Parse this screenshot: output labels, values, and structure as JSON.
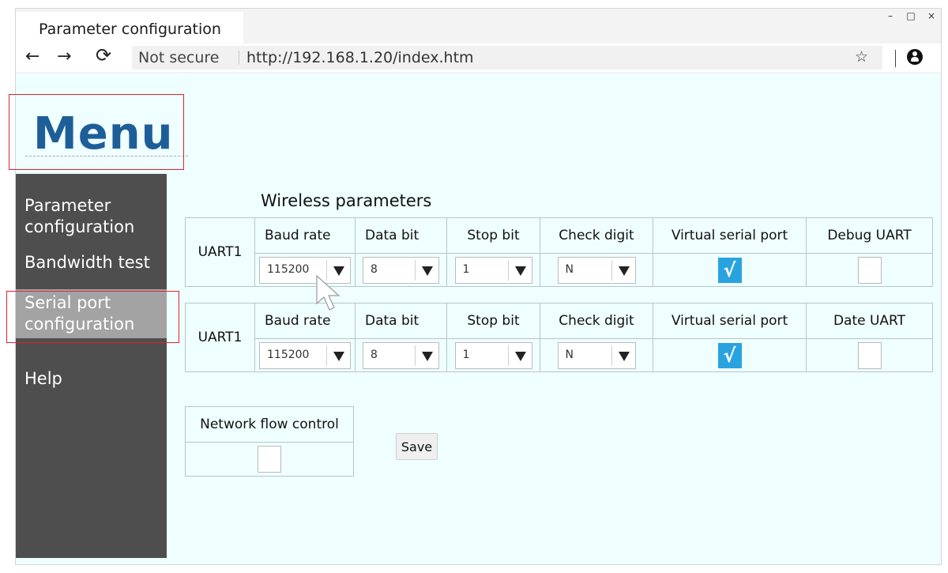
{
  "window": {
    "tab_title": "Parameter configuration",
    "controls": [
      "–",
      "□",
      "×"
    ]
  },
  "toolbar": {
    "back_icon": "←",
    "forward_icon": "→",
    "reload_icon": "⟳",
    "security_text": "Not secure",
    "url": "http://192.168.1.20/index.htm",
    "star_icon": "☆"
  },
  "page": {
    "menu_title": "Menu",
    "sidebar": [
      {
        "label": "Parameter configuration",
        "active": false
      },
      {
        "label": "Bandwidth test",
        "active": false
      },
      {
        "label": "Serial port configuration",
        "active": true
      },
      {
        "label": "Help",
        "active": false
      }
    ],
    "section_title": "Wireless parameters",
    "uart_tables": [
      {
        "row_label": "UART1",
        "headers": [
          "Baud rate",
          "Data bit",
          "Stop bit",
          "Check digit",
          "Virtual serial port",
          "Debug UART"
        ],
        "baud_rate": "115200",
        "data_bit": "8",
        "stop_bit": "1",
        "check_digit": "N",
        "virtual_serial_port": true,
        "last_checkbox": false
      },
      {
        "row_label": "UART1",
        "headers": [
          "Baud rate",
          "Data bit",
          "Stop bit",
          "Check digit",
          "Virtual serial port",
          "Date UART"
        ],
        "baud_rate": "115200",
        "data_bit": "8",
        "stop_bit": "1",
        "check_digit": "N",
        "virtual_serial_port": true,
        "last_checkbox": false
      }
    ],
    "flow_control": {
      "header": "Network flow control",
      "checked": false
    },
    "save_label": "Save",
    "check_mark": "√"
  },
  "colors": {
    "menu_title": "#1d5e99",
    "sidebar_bg": "#4e4e4e",
    "sidebar_active": "#a3a3a3",
    "page_bg": "#effefe",
    "checkbox_on": "#29a3e0",
    "highlight_box": "#e0242a"
  }
}
